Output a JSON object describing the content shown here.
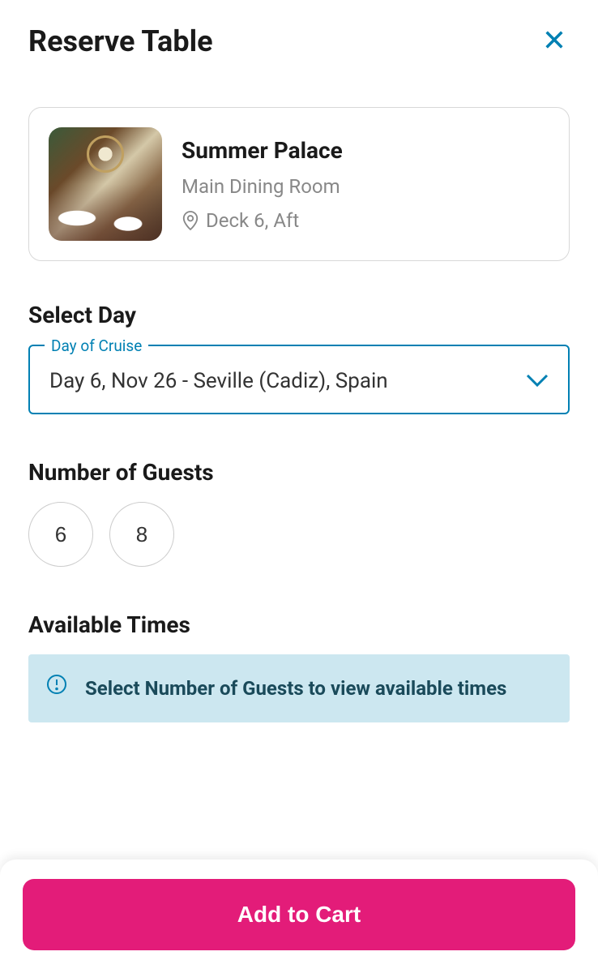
{
  "header": {
    "title": "Reserve Table"
  },
  "venue": {
    "name": "Summer Palace",
    "subtitle": "Main Dining Room",
    "location": "Deck 6, Aft"
  },
  "daySelect": {
    "sectionLabel": "Select Day",
    "floatingLabel": "Day of Cruise",
    "value": "Day 6, Nov 26 - Seville (Cadiz), Spain"
  },
  "guests": {
    "sectionLabel": "Number of Guests",
    "options": [
      "6",
      "8"
    ]
  },
  "times": {
    "sectionLabel": "Available Times",
    "infoMessage": "Select Number of Guests to view available times"
  },
  "footer": {
    "addToCartLabel": "Add to Cart"
  },
  "colors": {
    "accent": "#0080b3",
    "primary": "#e31c79",
    "infoBg": "#cce7f0"
  }
}
